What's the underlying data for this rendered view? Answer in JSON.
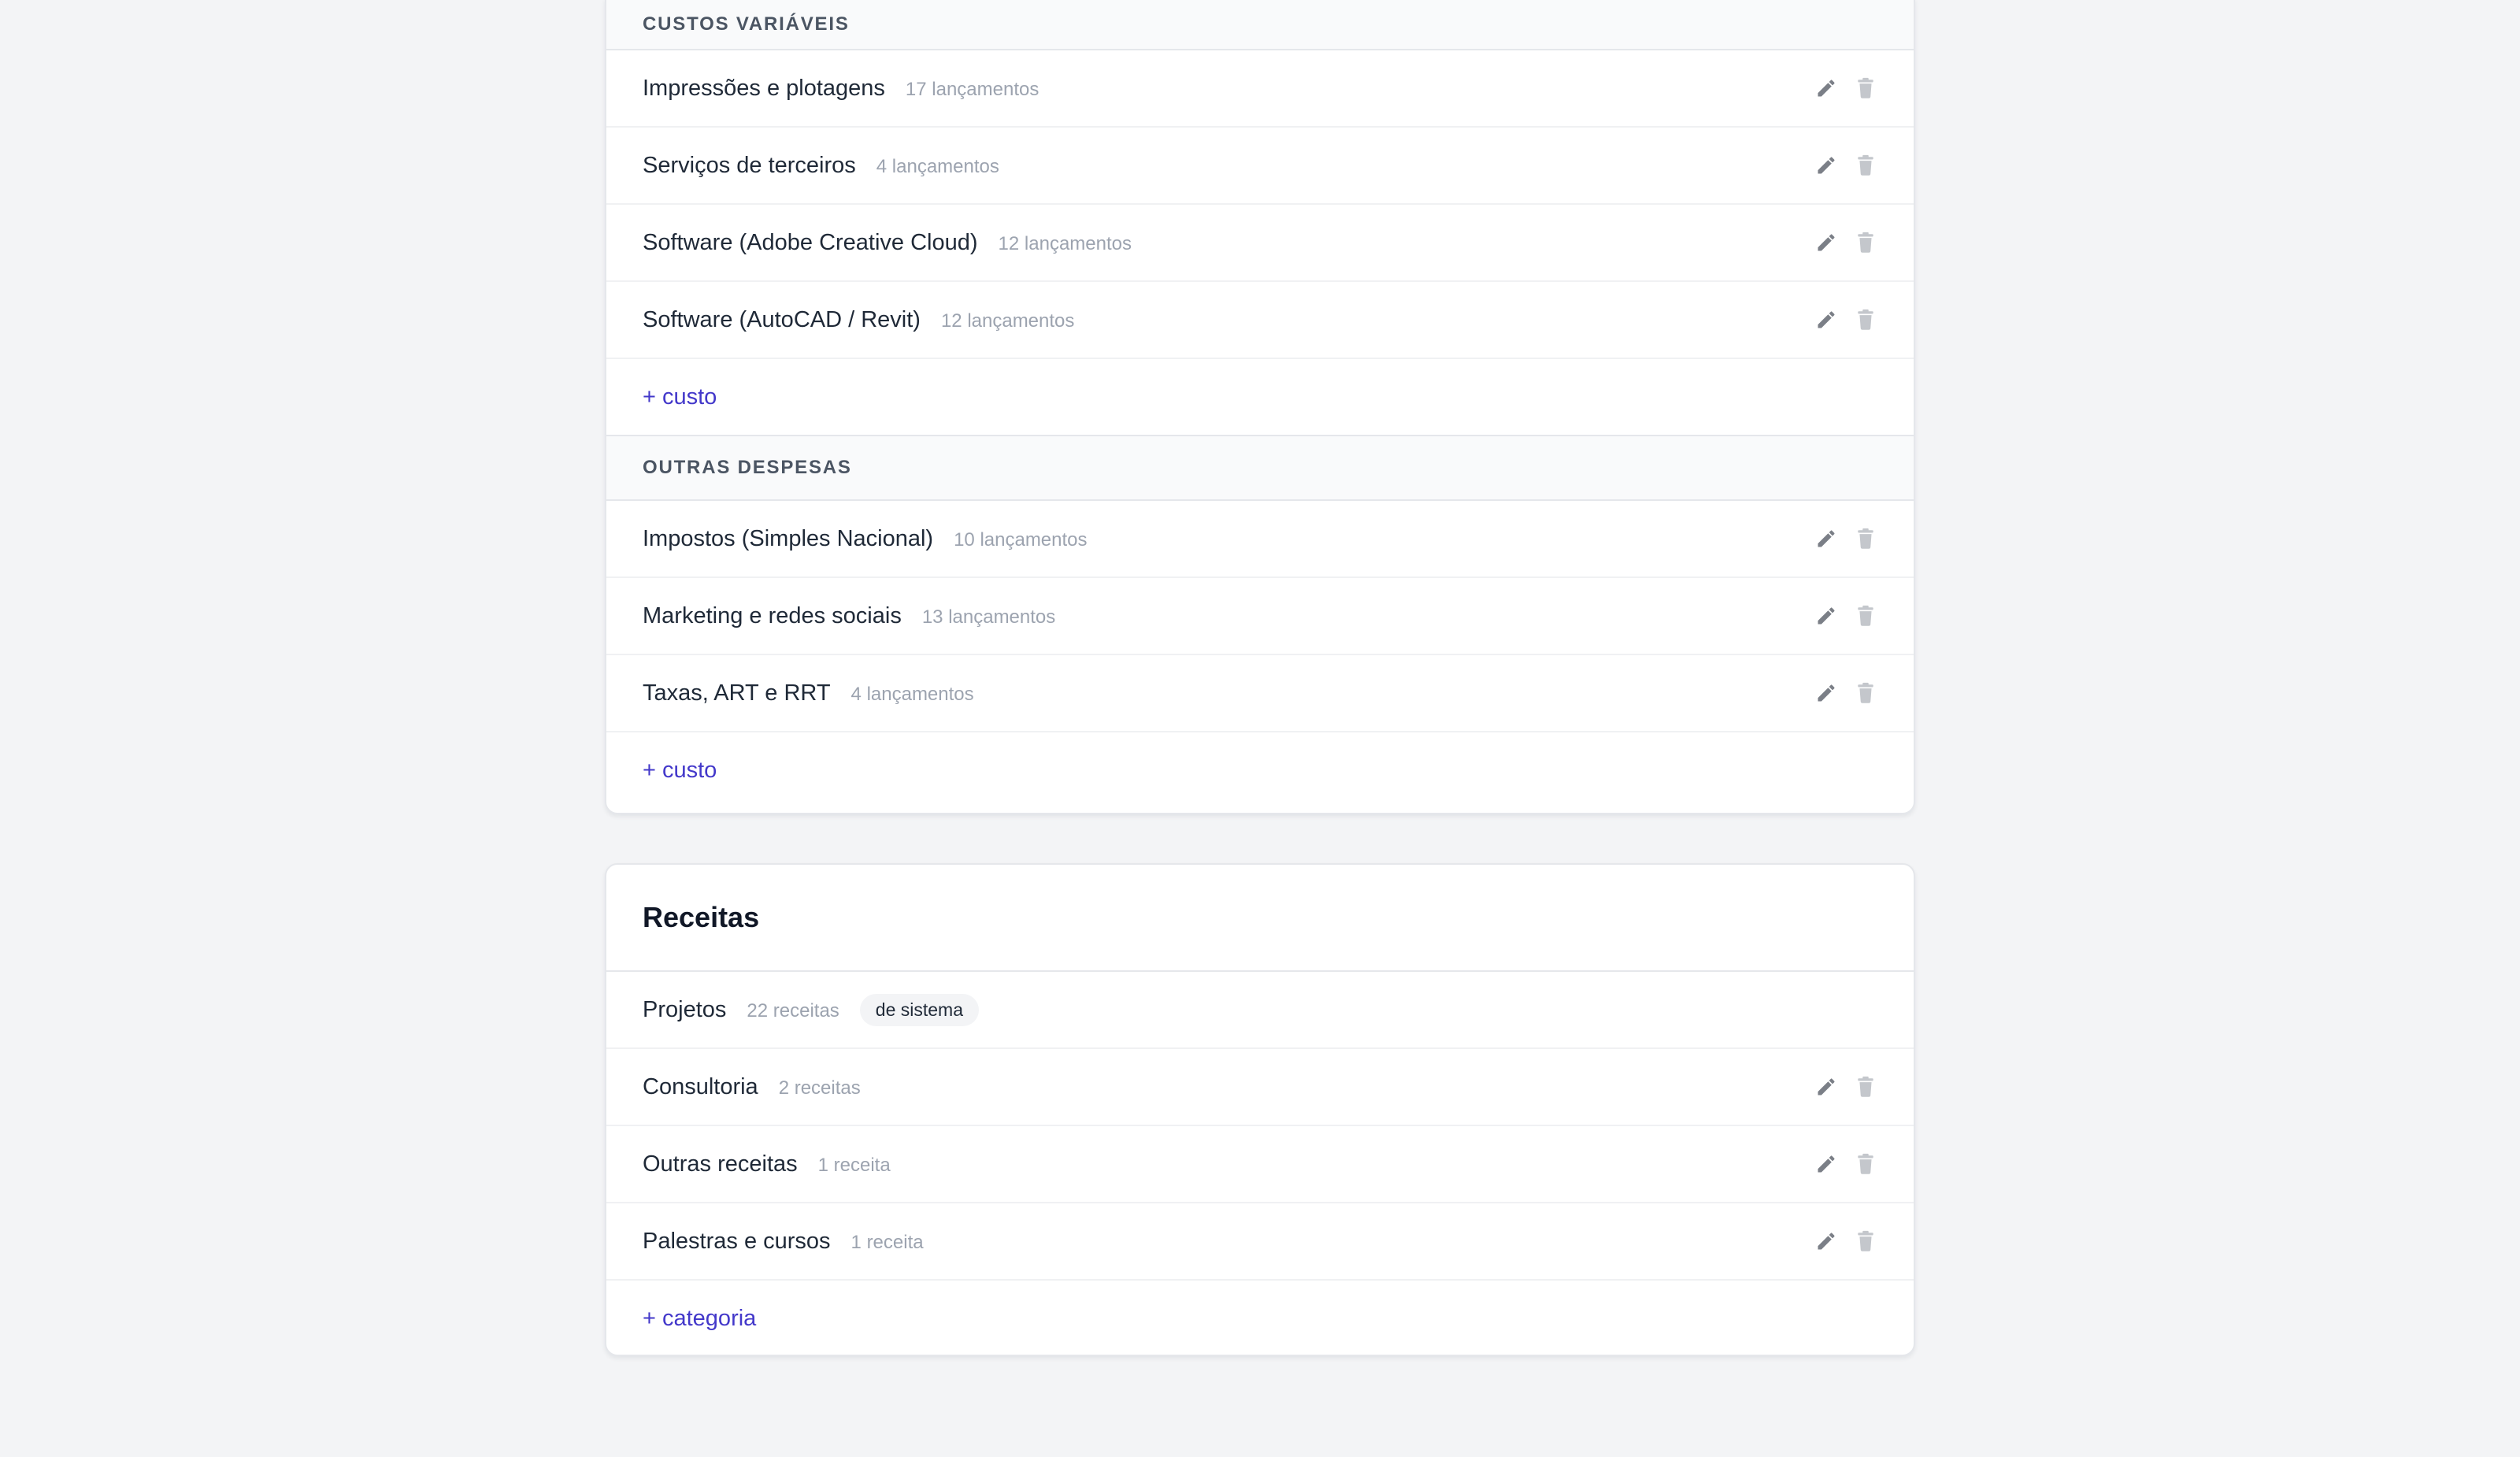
{
  "expenses": {
    "groups": [
      {
        "title": "CUSTOS VARIÁVEIS",
        "items": [
          {
            "name": "Impressões e plotagens",
            "count": "17 lançamentos"
          },
          {
            "name": "Serviços de terceiros",
            "count": "4 lançamentos"
          },
          {
            "name": "Software (Adobe Creative Cloud)",
            "count": "12 lançamentos"
          },
          {
            "name": "Software (AutoCAD / Revit)",
            "count": "12 lançamentos"
          }
        ],
        "add_label": "+ custo"
      },
      {
        "title": "OUTRAS DESPESAS",
        "items": [
          {
            "name": "Impostos (Simples Nacional)",
            "count": "10 lançamentos"
          },
          {
            "name": "Marketing e redes sociais",
            "count": "13 lançamentos"
          },
          {
            "name": "Taxas, ART e RRT",
            "count": "4 lançamentos"
          }
        ],
        "add_label": "+ custo"
      }
    ]
  },
  "revenue": {
    "title": "Receitas",
    "items": [
      {
        "name": "Projetos",
        "count": "22 receitas",
        "badge": "de sistema"
      },
      {
        "name": "Consultoria",
        "count": "2 receitas"
      },
      {
        "name": "Outras receitas",
        "count": "1 receita"
      },
      {
        "name": "Palestras e cursos",
        "count": "1 receita"
      }
    ],
    "add_label": "+ categoria"
  },
  "icons": {
    "edit": "pencil-icon",
    "delete": "trash-icon"
  },
  "colors": {
    "accent": "#4338ca",
    "icon_edit": "#7b7f87",
    "icon_delete": "#c4c7cc",
    "page_bg": "#f3f4f6"
  }
}
